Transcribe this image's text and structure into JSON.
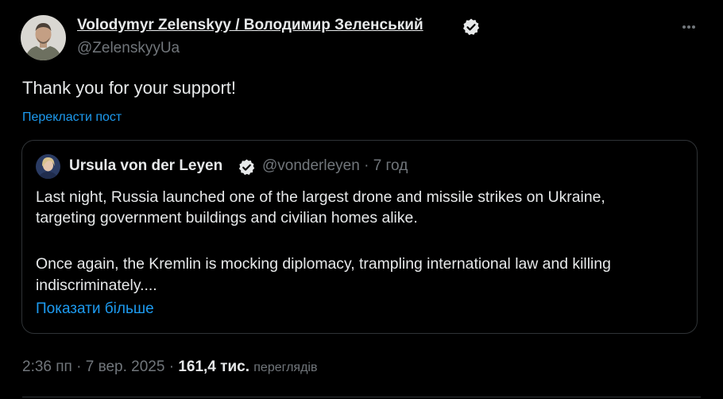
{
  "author": {
    "name": "Volodymyr Zelenskyy / Володимир Зеленський",
    "handle": "@ZelenskyyUa",
    "verified": true
  },
  "tweet": {
    "text": "Thank you for your support!",
    "translate_label": "Перекласти пост"
  },
  "quote": {
    "name": "Ursula von der Leyen",
    "handle": "@vonderleyen",
    "time": "7 год",
    "lines": [
      "Last night, Russia launched one of the largest drone and missile strikes on Ukraine,",
      "targeting government buildings and civilian homes alike.",
      "Once again, the Kremlin is mocking diplomacy, trampling international law and killing",
      "indiscriminately...."
    ],
    "show_more_label": "Показати більше"
  },
  "meta": {
    "time": "2:36 пп",
    "date": "7 вер. 2025",
    "separator": "·",
    "views_count": "161,4 тис.",
    "views_label": "переглядів"
  },
  "colors": {
    "background": "#000000",
    "text_primary": "#e7e9ea",
    "text_secondary": "#71767b",
    "accent": "#1d9bf0",
    "border": "#2f3336"
  },
  "icons": {
    "verified": "verified-badge-icon",
    "more": "more-horizontal-icon"
  }
}
